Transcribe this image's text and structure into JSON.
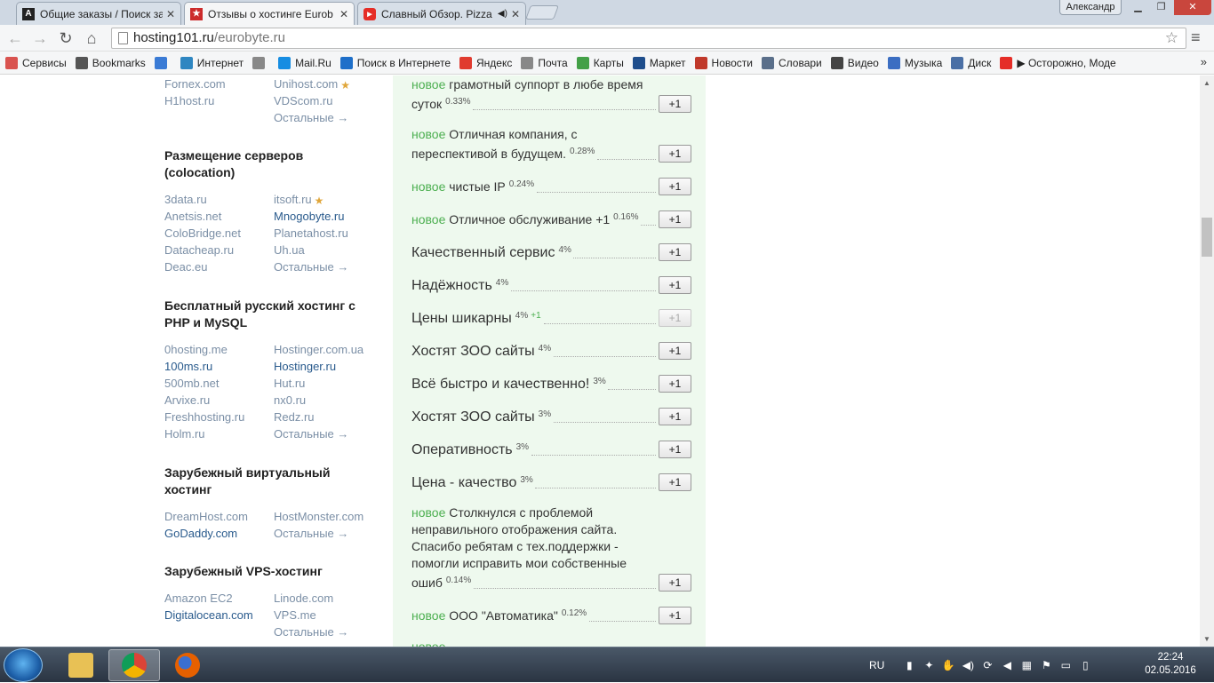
{
  "browser": {
    "tabs": [
      {
        "label": "Общие заказы / Поиск за",
        "favicon": "A",
        "favicon_color": "#222222"
      },
      {
        "label": "Отзывы о хостинге Eurob",
        "favicon": "★",
        "favicon_color": "#cc2b2b"
      },
      {
        "label": "Славный Обзор. Pizza",
        "favicon": "▶",
        "favicon_color": "#e52d27"
      }
    ],
    "user": "Александр",
    "url_host": "hosting101.ru",
    "url_path": "/eurobyte.ru",
    "bookmarks": [
      {
        "label": "Сервисы",
        "icon": "apps-grid-icon",
        "color": "#d9534f"
      },
      {
        "label": "Bookmarks",
        "icon": "star-icon",
        "color": "#555555"
      },
      {
        "label": "",
        "icon": "sb-icon",
        "color": "#3a7bd5"
      },
      {
        "label": "Интернет",
        "icon": "globe-icon",
        "color": "#2e86c1"
      },
      {
        "label": "",
        "icon": "page-icon",
        "color": "#888888"
      },
      {
        "label": "Mail.Ru",
        "icon": "mailru-icon",
        "color": "#168de2"
      },
      {
        "label": "Поиск в Интернете",
        "icon": "search-icon",
        "color": "#1e6fc9"
      },
      {
        "label": "Яндекс",
        "icon": "yandex-icon",
        "color": "#e03b2f"
      },
      {
        "label": "Почта",
        "icon": "page-icon",
        "color": "#888888"
      },
      {
        "label": "Карты",
        "icon": "map-icon",
        "color": "#43a047"
      },
      {
        "label": "Маркет",
        "icon": "cart-icon",
        "color": "#1f4e8c"
      },
      {
        "label": "Новости",
        "icon": "news-icon",
        "color": "#c0392b"
      },
      {
        "label": "Словари",
        "icon": "dictionary-icon",
        "color": "#5a6f8a"
      },
      {
        "label": "Видео",
        "icon": "video-icon",
        "color": "#444444"
      },
      {
        "label": "Музыка",
        "icon": "music-icon",
        "color": "#3b6ec2"
      },
      {
        "label": "Диск",
        "icon": "disk-icon",
        "color": "#4a6fa5"
      },
      {
        "label": "▶ Осторожно, Моде",
        "icon": "youtube-icon",
        "color": "#e52d27"
      }
    ],
    "bookmarks_more": "»"
  },
  "sidebar": {
    "top_rows": [
      {
        "left": "Fornex.com",
        "right": "Unihost.com",
        "right_medal": true
      },
      {
        "left": "H1host.ru",
        "right": "VDScom.ru"
      },
      {
        "left": "",
        "right": "Остальные →"
      }
    ],
    "sections": [
      {
        "title": "Размещение серверов (colocation)",
        "items": [
          {
            "left": "3data.ru",
            "right": "itsoft.ru",
            "right_medal": true
          },
          {
            "left": "Anetsis.net",
            "right": "Mnogobyte.ru",
            "right_dark": true
          },
          {
            "left": "ColoBridge.net",
            "right": "Planetahost.ru"
          },
          {
            "left": "Datacheap.ru",
            "right": "Uh.ua"
          },
          {
            "left": "Deac.eu",
            "right": "Остальные →"
          }
        ]
      },
      {
        "title": "Бесплатный русский хостинг с PHP и MySQL",
        "items": [
          {
            "left": "0hosting.me",
            "right": "Hostinger.com.ua"
          },
          {
            "left": "100ms.ru",
            "right": "Hostinger.ru",
            "left_dark": true,
            "right_dark": true
          },
          {
            "left": "500mb.net",
            "right": "Hut.ru"
          },
          {
            "left": "Arvixe.ru",
            "right": "nx0.ru"
          },
          {
            "left": "Freshhosting.ru",
            "right": "Redz.ru"
          },
          {
            "left": "Holm.ru",
            "right": "Остальные →"
          }
        ]
      },
      {
        "title": "Зарубежный виртуальный хостинг",
        "items": [
          {
            "left": "DreamHost.com",
            "right": "HostMonster.com"
          },
          {
            "left": "GoDaddy.com",
            "right": "Остальные →",
            "left_dark": true
          }
        ]
      },
      {
        "title": "Зарубежный VPS-хостинг",
        "items": [
          {
            "left": "Amazon EC2",
            "right": "Linode.com"
          },
          {
            "left": "Digitalocean.com",
            "right": "VPS.me",
            "left_dark": true
          },
          {
            "left": "",
            "right": "Остальные →"
          }
        ]
      }
    ]
  },
  "reviews": {
    "new_label": "новое",
    "vote_label": "+1",
    "items": [
      {
        "kind": "new",
        "lines": [
          "грамотный суппорт в любе время",
          "суток"
        ],
        "pct": "0.33%"
      },
      {
        "kind": "new",
        "lines": [
          "Отличная компания, с",
          "переспективой в будущем."
        ],
        "pct": "0.28%"
      },
      {
        "kind": "new",
        "lines": [
          "чистые IP"
        ],
        "pct": "0.24%"
      },
      {
        "kind": "new",
        "lines": [
          "Отличное обслуживание +1"
        ],
        "pct": "0.16%"
      },
      {
        "kind": "big",
        "lines": [
          "Качественный сервис"
        ],
        "pct": "4%"
      },
      {
        "kind": "big",
        "lines": [
          "Надёжность"
        ],
        "pct": "4%"
      },
      {
        "kind": "big",
        "lines": [
          "Цены шикарны"
        ],
        "pct": "4%",
        "plus": "+1",
        "disabled": true
      },
      {
        "kind": "big",
        "lines": [
          "Хостят ЗОО сайты"
        ],
        "pct": "4%"
      },
      {
        "kind": "big",
        "lines": [
          "Всё быстро и качественно!"
        ],
        "pct": "3%"
      },
      {
        "kind": "big",
        "lines": [
          "Хостят ЗОО сайты"
        ],
        "pct": "3%"
      },
      {
        "kind": "big",
        "lines": [
          "Оперативность"
        ],
        "pct": "3%"
      },
      {
        "kind": "big",
        "lines": [
          "Цена - качество"
        ],
        "pct": "3%"
      },
      {
        "kind": "new",
        "lines": [
          "Столкнулся с проблемой",
          "неправильного отображения сайта.",
          "Спасибо ребятам с тех.поддержки -",
          "помогли исправить мои собственные",
          "ошиб"
        ],
        "pct": "0.14%"
      },
      {
        "kind": "new",
        "lines": [
          "ООО \"Автоматика\""
        ],
        "pct": "0.12%"
      }
    ]
  },
  "taskbar": {
    "apps": [
      {
        "name": "explorer",
        "color": "#e8c155",
        "active": false
      },
      {
        "name": "chrome",
        "color": "#4285f4",
        "active": true
      },
      {
        "name": "firefox",
        "color": "#e66000",
        "active": false
      }
    ],
    "lang": "RU",
    "time": "22:24",
    "date": "02.05.2016"
  }
}
